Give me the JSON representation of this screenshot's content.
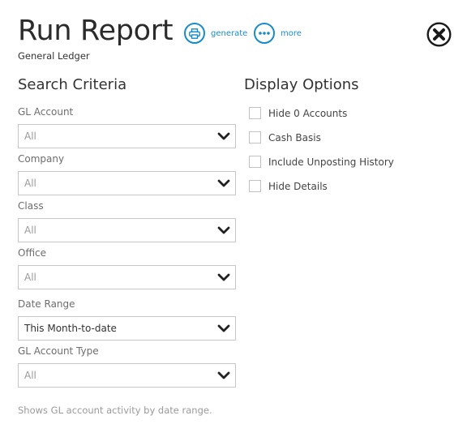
{
  "header": {
    "title": "Run Report",
    "subtitle": "General Ledger",
    "actions": [
      {
        "label": "generate",
        "icon": "print-icon"
      },
      {
        "label": "more",
        "icon": "more-dots-icon"
      }
    ],
    "close_icon": "close-icon"
  },
  "search_criteria": {
    "title": "Search Criteria",
    "fields": [
      {
        "label": "GL Account",
        "value": "All"
      },
      {
        "label": "Company",
        "value": "All"
      },
      {
        "label": "Class",
        "value": "All"
      },
      {
        "label": "Office",
        "value": "All"
      },
      {
        "label": "Date Range",
        "value": "This Month-to-date"
      },
      {
        "label": "GL Account Type",
        "value": "All"
      }
    ]
  },
  "display_options": {
    "title": "Display Options",
    "options": [
      {
        "label": "Hide 0 Accounts",
        "checked": false
      },
      {
        "label": "Cash Basis",
        "checked": false
      },
      {
        "label": "Include Unposting History",
        "checked": false
      },
      {
        "label": "Hide Details",
        "checked": false
      }
    ]
  },
  "footer": {
    "note": "Shows GL account activity by date range."
  },
  "colors": {
    "accent": "#1a8bc9",
    "text": "#333333",
    "muted": "#9a9a9a",
    "border": "#c7c7c7"
  }
}
